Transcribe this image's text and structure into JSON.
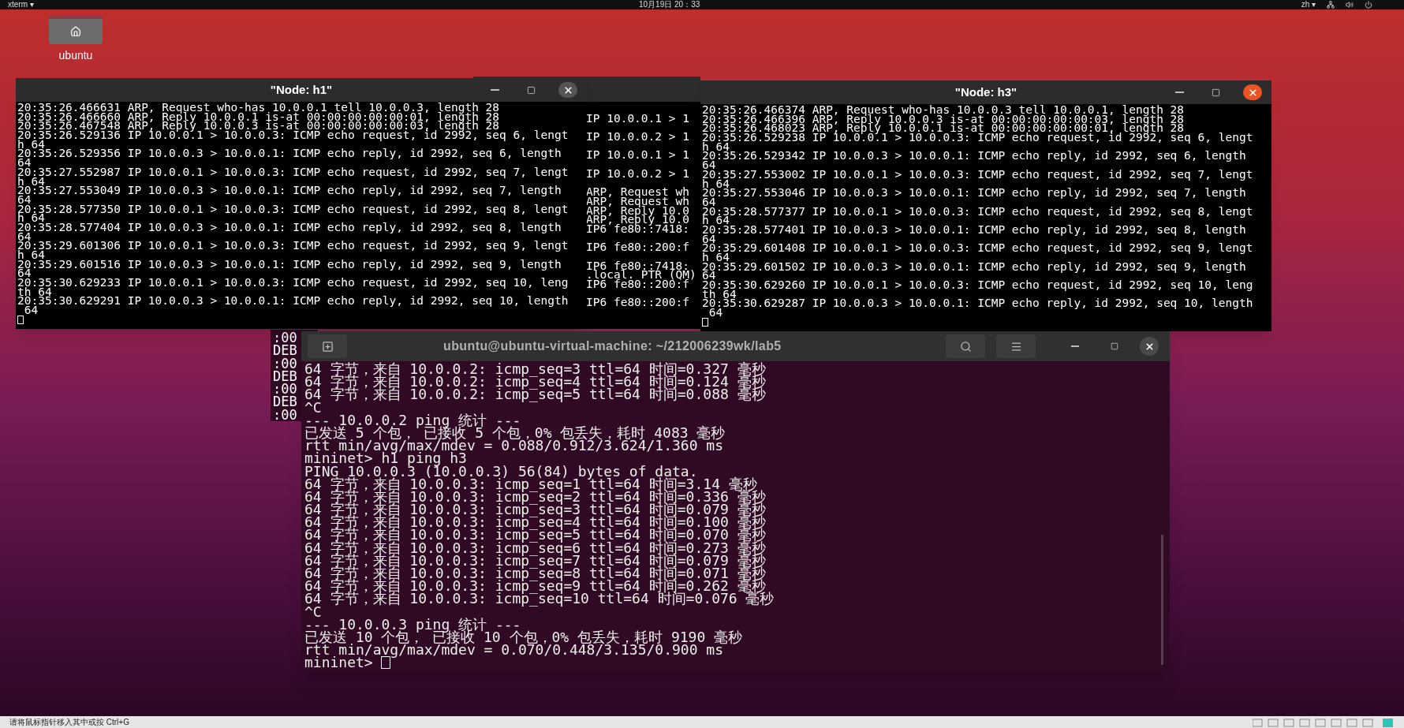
{
  "top_bar": {
    "app_menu": "xterm ▾",
    "clock": "10月19日 20：33",
    "input_method": "zh ▾"
  },
  "desktop_icons": [
    {
      "label": "ubuntu"
    }
  ],
  "left_back_window": {
    "lines": [
      ":00",
      "DEB",
      ":00",
      "DEB",
      ":00",
      "DEB",
      ":00"
    ]
  },
  "right_back_window": {
    "blocks": [
      [
        "IP 10.0.0.1 > 1"
      ],
      [
        "IP 10.0.0.2 > 1"
      ],
      [
        "IP 10.0.0.1 > 1"
      ],
      [
        "IP 10.0.0.2 > 1"
      ],
      [
        "ARP, Request wh",
        "ARP, Request wh",
        "ARP, Reply 10.0",
        "ARP, Reply 10.0",
        "IP6 fe80::7418:"
      ],
      [
        "IP6 fe80::200:f"
      ],
      [
        "IP6 fe80::7418:",
        ".local. PTR (QM)",
        "IP6 fe80::200:f"
      ],
      [
        "IP6 fe80::200:f"
      ]
    ]
  },
  "xterm_windows": [
    {
      "title": "\"Node: h1\"",
      "focused": false,
      "lines": [
        "20:35:26.466631 ARP, Request who-has 10.0.0.1 tell 10.0.0.3, length 28",
        "20:35:26.466660 ARP, Reply 10.0.0.1 is-at 00:00:00:00:00:01, length 28",
        "20:35:26.467548 ARP, Reply 10.0.0.3 is-at 00:00:00:00:00:03, length 28",
        "20:35:26.529136 IP 10.0.0.1 > 10.0.0.3: ICMP echo request, id 2992, seq 6, lengt",
        "h 64",
        "20:35:26.529356 IP 10.0.0.3 > 10.0.0.1: ICMP echo reply, id 2992, seq 6, length",
        "64",
        "20:35:27.552987 IP 10.0.0.1 > 10.0.0.3: ICMP echo request, id 2992, seq 7, lengt",
        "h 64",
        "20:35:27.553049 IP 10.0.0.3 > 10.0.0.1: ICMP echo reply, id 2992, seq 7, length",
        "64",
        "20:35:28.577350 IP 10.0.0.1 > 10.0.0.3: ICMP echo request, id 2992, seq 8, lengt",
        "h 64",
        "20:35:28.577404 IP 10.0.0.3 > 10.0.0.1: ICMP echo reply, id 2992, seq 8, length",
        "64",
        "20:35:29.601306 IP 10.0.0.1 > 10.0.0.3: ICMP echo request, id 2992, seq 9, lengt",
        "h 64",
        "20:35:29.601516 IP 10.0.0.3 > 10.0.0.1: ICMP echo reply, id 2992, seq 9, length",
        "64",
        "20:35:30.629233 IP 10.0.0.1 > 10.0.0.3: ICMP echo request, id 2992, seq 10, leng",
        "th 64",
        "20:35:30.629291 IP 10.0.0.3 > 10.0.0.1: ICMP echo reply, id 2992, seq 10, length",
        " 64"
      ]
    },
    {
      "title": "\"Node: h3\"",
      "focused": true,
      "lines": [
        "20:35:26.466374 ARP, Request who-has 10.0.0.3 tell 10.0.0.1, length 28",
        "20:35:26.466396 ARP, Reply 10.0.0.3 is-at 00:00:00:00:00:03, length 28",
        "20:35:26.468023 ARP, Reply 10.0.0.1 is-at 00:00:00:00:00:01, length 28",
        "20:35:26.529238 IP 10.0.0.1 > 10.0.0.3: ICMP echo request, id 2992, seq 6, lengt",
        "h 64",
        "20:35:26.529342 IP 10.0.0.3 > 10.0.0.1: ICMP echo reply, id 2992, seq 6, length",
        "64",
        "20:35:27.553002 IP 10.0.0.1 > 10.0.0.3: ICMP echo request, id 2992, seq 7, lengt",
        "h 64",
        "20:35:27.553046 IP 10.0.0.3 > 10.0.0.1: ICMP echo reply, id 2992, seq 7, length",
        "64",
        "20:35:28.577377 IP 10.0.0.1 > 10.0.0.3: ICMP echo request, id 2992, seq 8, lengt",
        "h 64",
        "20:35:28.577401 IP 10.0.0.3 > 10.0.0.1: ICMP echo reply, id 2992, seq 8, length",
        "64",
        "20:35:29.601408 IP 10.0.0.1 > 10.0.0.3: ICMP echo request, id 2992, seq 9, lengt",
        "h 64",
        "20:35:29.601502 IP 10.0.0.3 > 10.0.0.1: ICMP echo reply, id 2992, seq 9, length",
        "64",
        "20:35:30.629260 IP 10.0.0.1 > 10.0.0.3: ICMP echo request, id 2992, seq 10, leng",
        "th 64",
        "20:35:30.629287 IP 10.0.0.3 > 10.0.0.1: ICMP echo reply, id 2992, seq 10, length",
        " 64"
      ]
    }
  ],
  "terminal": {
    "title": "ubuntu@ubuntu-virtual-machine: ~/212006239wk/lab5",
    "lines": [
      "64 字节，来自 10.0.0.2: icmp_seq=3 ttl=64 时间=0.327 毫秒",
      "64 字节，来自 10.0.0.2: icmp_seq=4 ttl=64 时间=0.124 毫秒",
      "64 字节，来自 10.0.0.2: icmp_seq=5 ttl=64 时间=0.088 毫秒",
      "^C",
      "--- 10.0.0.2 ping 统计 ---",
      "已发送 5 个包， 已接收 5 个包，0% 包丢失，耗时 4083 毫秒",
      "rtt min/avg/max/mdev = 0.088/0.912/3.624/1.360 ms",
      "mininet> h1 ping h3",
      "PING 10.0.0.3 (10.0.0.3) 56(84) bytes of data.",
      "64 字节，来自 10.0.0.3: icmp_seq=1 ttl=64 时间=3.14 毫秒",
      "64 字节，来自 10.0.0.3: icmp_seq=2 ttl=64 时间=0.336 毫秒",
      "64 字节，来自 10.0.0.3: icmp_seq=3 ttl=64 时间=0.079 毫秒",
      "64 字节，来自 10.0.0.3: icmp_seq=4 ttl=64 时间=0.100 毫秒",
      "64 字节，来自 10.0.0.3: icmp_seq=5 ttl=64 时间=0.070 毫秒",
      "64 字节，来自 10.0.0.3: icmp_seq=6 ttl=64 时间=0.273 毫秒",
      "64 字节，来自 10.0.0.3: icmp_seq=7 ttl=64 时间=0.079 毫秒",
      "64 字节，来自 10.0.0.3: icmp_seq=8 ttl=64 时间=0.071 毫秒",
      "64 字节，来自 10.0.0.3: icmp_seq=9 ttl=64 时间=0.262 毫秒",
      "64 字节，来自 10.0.0.3: icmp_seq=10 ttl=64 时间=0.076 毫秒",
      "^C",
      "--- 10.0.0.3 ping 统计 ---",
      "已发送 10 个包， 已接收 10 个包，0% 包丢失，耗时 9190 毫秒",
      "rtt min/avg/max/mdev = 0.070/0.448/3.135/0.900 ms"
    ],
    "prompt": "mininet>"
  },
  "status_bar": {
    "hint": "请将鼠标指针移入其中或按 Ctrl+G"
  }
}
